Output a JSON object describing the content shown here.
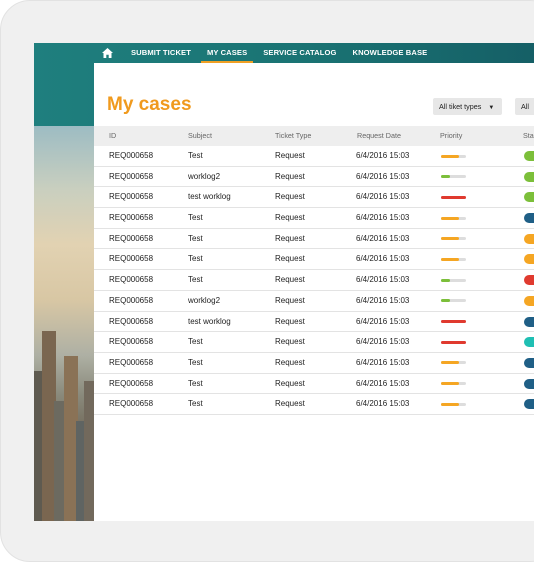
{
  "nav": {
    "home_icon": "home-icon",
    "items": [
      {
        "label": "SUBMIT TICKET",
        "active": false
      },
      {
        "label": "MY CASES",
        "active": true
      },
      {
        "label": "SERVICE CATALOG",
        "active": false
      },
      {
        "label": "KNOWLEDGE BASE",
        "active": false
      }
    ]
  },
  "page": {
    "title": "My cases",
    "filters": [
      {
        "label": "All tiket types"
      },
      {
        "label": "All"
      }
    ]
  },
  "colors": {
    "accent": "#f09a1e",
    "teal": "#1a7373",
    "priority_orange": "#f5a623",
    "priority_green": "#7cbf3a",
    "priority_red": "#e03a2f"
  },
  "table": {
    "columns": [
      "ID",
      "Subject",
      "Ticket Type",
      "Request Date",
      "Priority",
      "Sta"
    ],
    "rows": [
      {
        "id": "REQ000658",
        "subject": "Test",
        "type": "Request",
        "date": "6/4/2016 15:03",
        "priority": "medium",
        "status_color": "#7cbf3a"
      },
      {
        "id": "REQ000658",
        "subject": "worklog2",
        "type": "Request",
        "date": "6/4/2016 15:03",
        "priority": "low",
        "status_color": "#7cbf3a"
      },
      {
        "id": "REQ000658",
        "subject": "test worklog",
        "type": "Request",
        "date": "6/4/2016 15:03",
        "priority": "high",
        "status_color": "#7cbf3a"
      },
      {
        "id": "REQ000658",
        "subject": "Test",
        "type": "Request",
        "date": "6/4/2016 15:03",
        "priority": "medium",
        "status_color": "#1f5f86"
      },
      {
        "id": "REQ000658",
        "subject": "Test",
        "type": "Request",
        "date": "6/4/2016 15:03",
        "priority": "medium",
        "status_color": "#f5a623"
      },
      {
        "id": "REQ000658",
        "subject": "Test",
        "type": "Request",
        "date": "6/4/2016 15:03",
        "priority": "medium",
        "status_color": "#f5a623"
      },
      {
        "id": "REQ000658",
        "subject": "Test",
        "type": "Request",
        "date": "6/4/2016 15:03",
        "priority": "low",
        "status_color": "#e03a2f"
      },
      {
        "id": "REQ000658",
        "subject": "worklog2",
        "type": "Request",
        "date": "6/4/2016 15:03",
        "priority": "low",
        "status_color": "#f5a623"
      },
      {
        "id": "REQ000658",
        "subject": "test worklog",
        "type": "Request",
        "date": "6/4/2016 15:03",
        "priority": "high",
        "status_color": "#1f5f86"
      },
      {
        "id": "REQ000658",
        "subject": "Test",
        "type": "Request",
        "date": "6/4/2016 15:03",
        "priority": "high",
        "status_color": "#1fbfb3"
      },
      {
        "id": "REQ000658",
        "subject": "Test",
        "type": "Request",
        "date": "6/4/2016 15:03",
        "priority": "medium",
        "status_color": "#1f5f86"
      },
      {
        "id": "REQ000658",
        "subject": "Test",
        "type": "Request",
        "date": "6/4/2016 15:03",
        "priority": "medium",
        "status_color": "#1f5f86"
      },
      {
        "id": "REQ000658",
        "subject": "Test",
        "type": "Request",
        "date": "6/4/2016 15:03",
        "priority": "medium",
        "status_color": "#1f5f86"
      }
    ]
  },
  "priority_levels": {
    "low": {
      "fill": 0.35,
      "color": "#7cbf3a"
    },
    "medium": {
      "fill": 0.7,
      "color": "#f5a623"
    },
    "high": {
      "fill": 1.0,
      "color": "#e03a2f"
    }
  }
}
